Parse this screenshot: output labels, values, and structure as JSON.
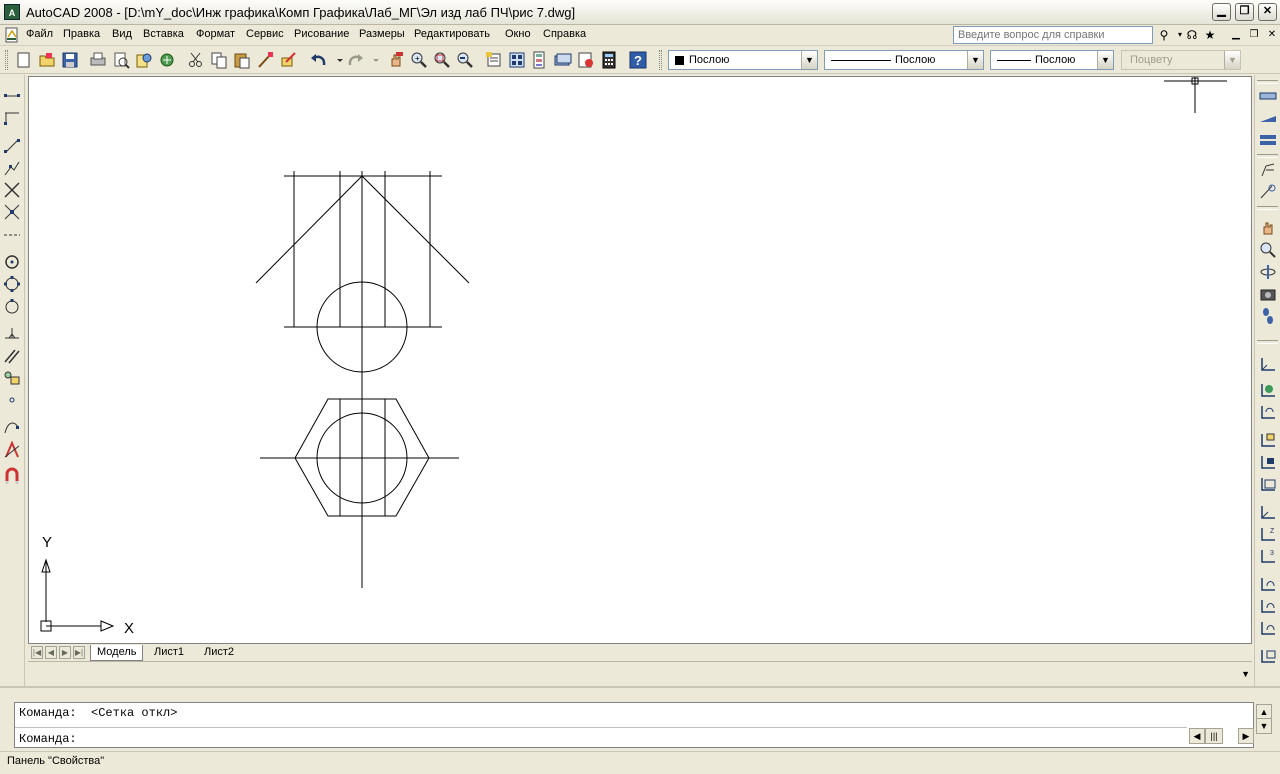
{
  "window": {
    "title": "AutoCAD 2008 - [D:\\mY_doc\\Инж графика\\Комп Графика\\Лаб_МГ\\Эл изд лаб ПЧ\\рис 7.dwg]",
    "app_icon": "A"
  },
  "menu": {
    "items": [
      "Файл",
      "Правка",
      "Вид",
      "Вставка",
      "Формат",
      "Сервис",
      "Рисование",
      "Размеры",
      "Редактировать",
      "Окно",
      "Справка"
    ],
    "help_placeholder": "Введите вопрос для справки"
  },
  "toolbar": {
    "color_dropdown": "Послою",
    "linetype_dropdown": "Послою",
    "lineweight_dropdown": "Послою",
    "plotstyle_dropdown": "Поцвету"
  },
  "tabs": [
    "Модель",
    "Лист1",
    "Лист2"
  ],
  "ucs": {
    "y_label": "Y",
    "x_label": "X"
  },
  "command": {
    "history": "Команда:  <Сетка откл>",
    "prompt": "Команда:"
  },
  "status": {
    "text": "Панель \"Свойства\""
  }
}
